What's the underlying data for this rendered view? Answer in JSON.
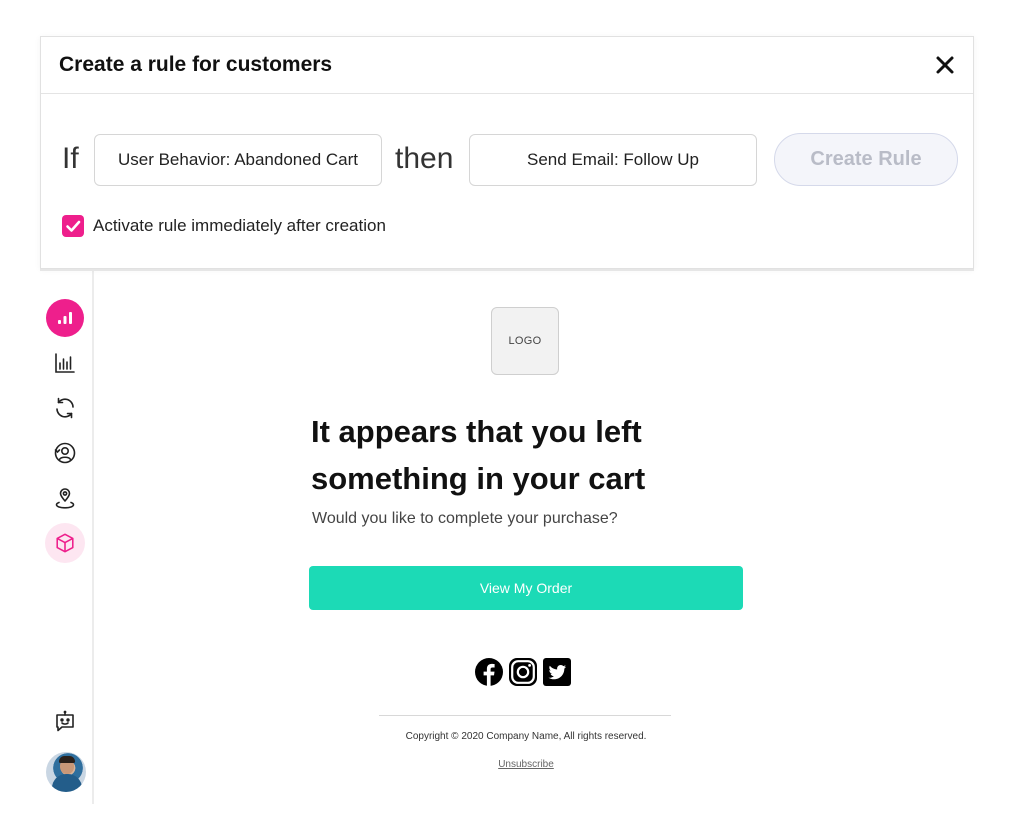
{
  "modal": {
    "title": "Create a rule for customers",
    "if_label": "If",
    "condition_value": "User Behavior: Abandoned Cart",
    "then_label": "then",
    "action_value": "Send Email: Follow Up",
    "create_button": "Create Rule",
    "activate_label": "Activate rule immediately after creation",
    "activate_checked": true
  },
  "sidebar": {
    "items": [
      {
        "icon": "analytics-icon",
        "active": true
      },
      {
        "icon": "bar-chart-icon",
        "active": false
      },
      {
        "icon": "sync-icon",
        "active": false
      },
      {
        "icon": "user-circle-icon",
        "active": false
      },
      {
        "icon": "location-user-icon",
        "active": false
      },
      {
        "icon": "cube-icon",
        "active": true
      }
    ],
    "bottom": [
      {
        "icon": "chatbot-icon"
      },
      {
        "icon": "user-avatar"
      }
    ]
  },
  "email": {
    "logo_text": "LOGO",
    "headline": "It appears that you left something in your cart",
    "subtext": "Would you like to complete your purchase?",
    "cta_label": "View My Order",
    "social": [
      "facebook-icon",
      "instagram-icon",
      "twitter-icon"
    ],
    "copyright": "Copyright © 2020 Company Name, All rights reserved.",
    "unsubscribe": "Unsubscribe"
  },
  "colors": {
    "accent_pink": "#ee1f8c",
    "accent_pink_soft": "#fde6f1",
    "cta_teal": "#1cdab6",
    "disabled_button_bg": "#f4f5fa",
    "disabled_button_text": "#b9bcc7"
  }
}
